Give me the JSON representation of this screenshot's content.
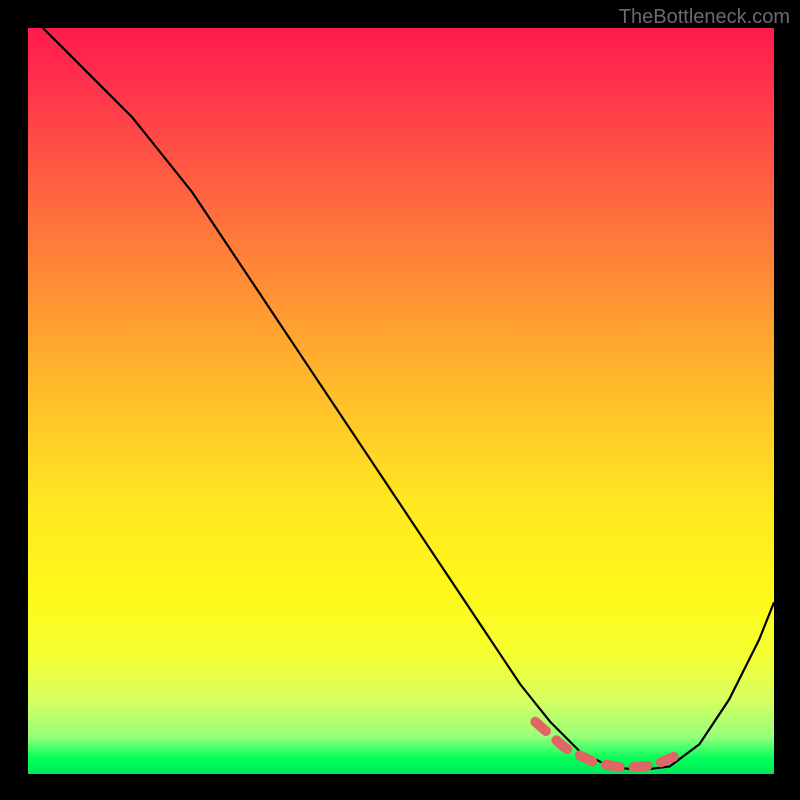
{
  "watermark": "TheBottleneck.com",
  "chart_data": {
    "type": "line",
    "title": "",
    "xlabel": "",
    "ylabel": "",
    "xlim": [
      0,
      100
    ],
    "ylim": [
      0,
      100
    ],
    "series": [
      {
        "name": "curve",
        "x": [
          2,
          6,
          10,
          14,
          18,
          22,
          26,
          30,
          34,
          38,
          42,
          46,
          50,
          54,
          58,
          62,
          66,
          70,
          74,
          78,
          82,
          86,
          90,
          94,
          98,
          100
        ],
        "y": [
          100,
          96,
          92,
          88,
          83,
          78,
          72,
          66,
          60,
          54,
          48,
          42,
          36,
          30,
          24,
          18,
          12,
          7,
          3,
          1,
          0.5,
          1,
          4,
          10,
          18,
          23
        ]
      }
    ],
    "marker": {
      "name": "optimal-range",
      "x": [
        68,
        72,
        76,
        80,
        84,
        87
      ],
      "y": [
        7,
        3.5,
        1.5,
        0.8,
        1.2,
        2.5
      ]
    },
    "grid": false,
    "legend": false,
    "background": "rainbow-vertical-gradient"
  }
}
